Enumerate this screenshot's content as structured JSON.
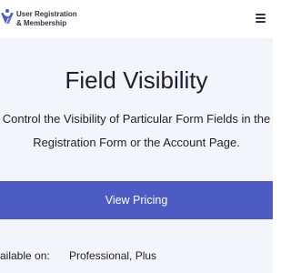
{
  "header": {
    "brand_line1": "User Registration",
    "brand_line2": "& Membership",
    "logo_icon": "ur-logo-icon",
    "menu_icon": "hamburger-menu-icon"
  },
  "hero": {
    "title": "Field Visibility",
    "description_line1": "Control the Visibility of Particular Form Fields in the",
    "description_line2": "Registration Form or the Account Page.",
    "cta_label": "View Pricing"
  },
  "availability": {
    "label": "vailable on:",
    "value": "Professional, Plus"
  },
  "colors": {
    "accent": "#4c5cc4",
    "background": "#f4f5fb",
    "text": "#1c1e2b"
  }
}
